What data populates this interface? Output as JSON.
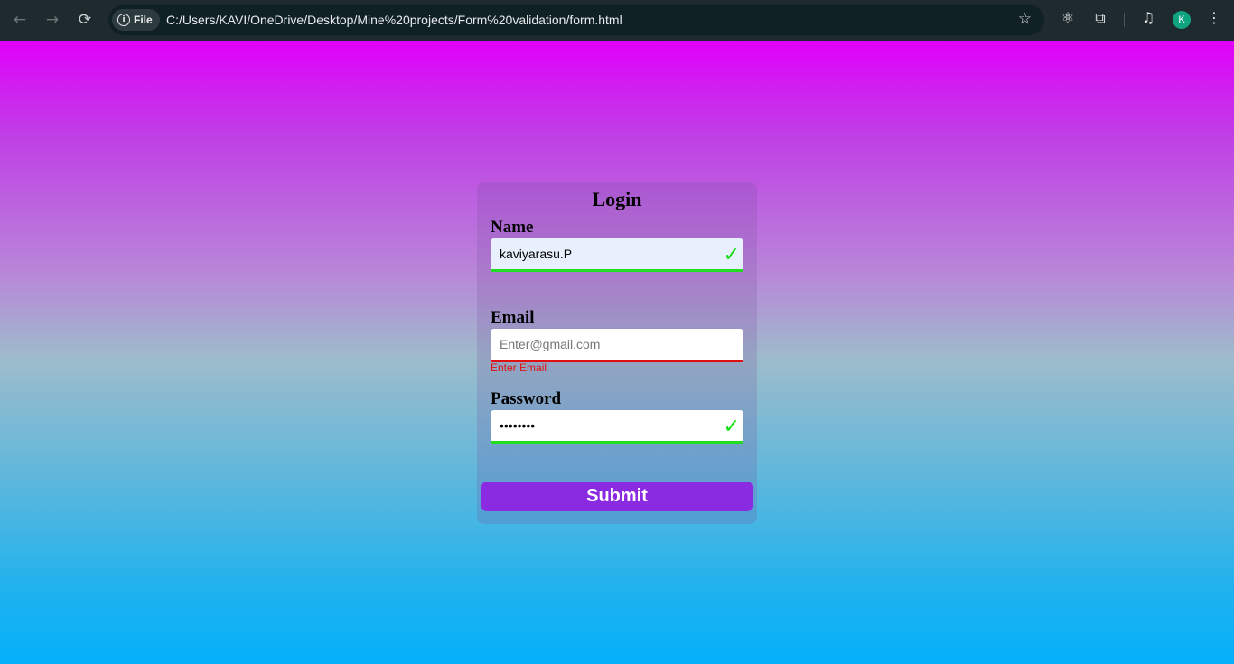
{
  "browser": {
    "back_icon": "←",
    "forward_icon": "→",
    "reload_icon": "⟳",
    "info_icon": "i",
    "site_chip_label": "File",
    "url": "C:/Users/KAVI/OneDrive/Desktop/Mine%20projects/Form%20validation/form.html",
    "star_icon": "☆",
    "react_icon": "⚛",
    "extensions_icon": "⧉",
    "media_icon": "♫",
    "menu_icon": "⋮",
    "avatar_initial": "K"
  },
  "form": {
    "title": "Login",
    "name_label": "Name",
    "name_value": "kaviyarasu.P",
    "email_label": "Email",
    "email_placeholder": "Enter@gmail.com",
    "email_error": "Enter Email",
    "password_label": "Password",
    "password_value": "kavi1234",
    "check_mark": "✓",
    "submit_label": "Submit"
  },
  "colors": {
    "accent": "#8a2be2",
    "success": "#22dd22",
    "error": "#e01010"
  }
}
